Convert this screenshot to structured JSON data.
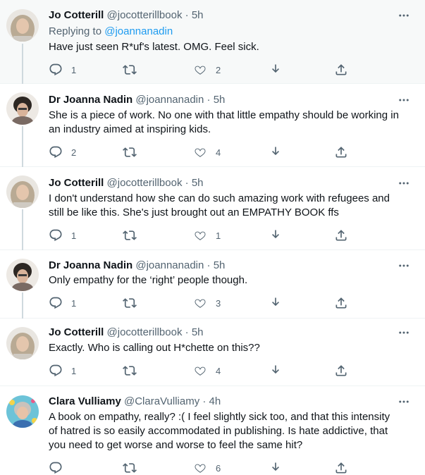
{
  "tweets": [
    {
      "name": "Jo Cotterill",
      "handle": "@jocotterillbook",
      "dot": "·",
      "time": "5h",
      "replying_prefix": "Replying to",
      "replying_handle": "@joannanadin",
      "text": "Have just seen R*uf's latest. OMG. Feel sick.",
      "reply_count": "1",
      "retweet_count": "",
      "like_count": "2"
    },
    {
      "name": "Dr Joanna Nadin",
      "handle": "@joannanadin",
      "dot": "·",
      "time": "5h",
      "text_lines": [
        "She is a piece of work. No one with that little empathy should be working in",
        "an industry aimed at inspiring kids."
      ],
      "reply_count": "2",
      "retweet_count": "",
      "like_count": "4"
    },
    {
      "name": "Jo Cotterill",
      "handle": "@jocotterillbook",
      "dot": "·",
      "time": "5h",
      "text_lines": [
        "I don't understand how she can do such amazing work with refugees and",
        "still be like this. She's just brought out an EMPATHY BOOK ffs"
      ],
      "reply_count": "1",
      "retweet_count": "",
      "like_count": "1"
    },
    {
      "name": "Dr Joanna Nadin",
      "handle": "@joannanadin",
      "dot": "·",
      "time": "5h",
      "text": "Only empathy for the ‘right’ people though.",
      "reply_count": "1",
      "retweet_count": "",
      "like_count": "3"
    },
    {
      "name": "Jo Cotterill",
      "handle": "@jocotterillbook",
      "dot": "·",
      "time": "5h",
      "text": "Exactly. Who is calling out H*chette on this??",
      "reply_count": "1",
      "retweet_count": "",
      "like_count": "4"
    },
    {
      "name": "Clara Vulliamy",
      "handle": "@ClaraVulliamy",
      "dot": "·",
      "time": "4h",
      "text_lines": [
        "A book on empathy, really? :( I feel slightly sick too, and that this intensity",
        "of hatred is so easily accommodated in publishing. Is hate addictive, that",
        "you need to get worse and worse to feel the same hit?"
      ],
      "reply_count": "",
      "retweet_count": "",
      "like_count": "6"
    }
  ],
  "colors": {
    "text": "#0f1419",
    "secondary": "#536471",
    "link": "#1d9bf0",
    "thread_line": "#cfd9de",
    "highlight_bg": "#f7f9f9"
  },
  "icons": [
    "more-icon",
    "reply-icon",
    "retweet-icon",
    "like-icon",
    "bookmark-icon",
    "share-icon"
  ]
}
